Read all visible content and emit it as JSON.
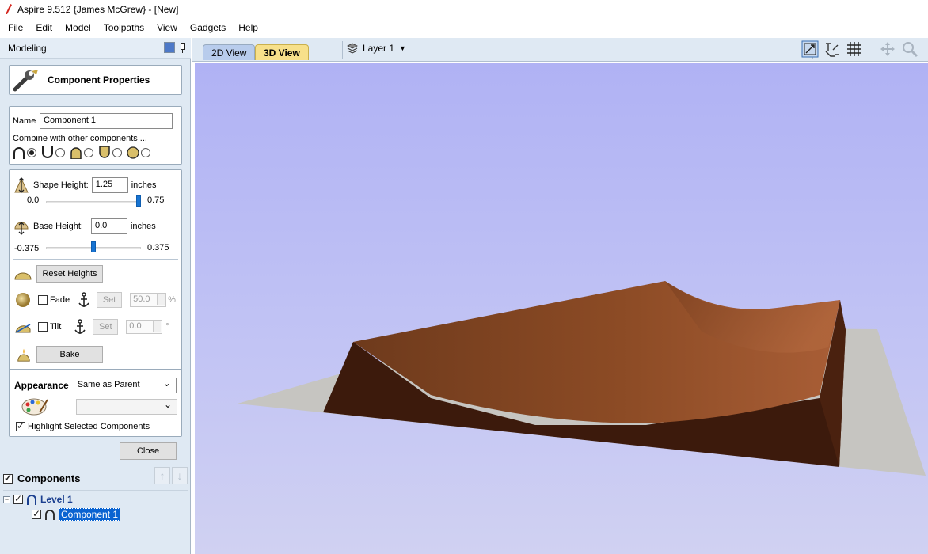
{
  "window": {
    "title": "Aspire 9.512 {James McGrew} - [New]"
  },
  "menu": [
    "File",
    "Edit",
    "Model",
    "Toolpaths",
    "View",
    "Gadgets",
    "Help"
  ],
  "left_panel": {
    "header": "Modeling",
    "form_title": "Component Properties",
    "name_label": "Name",
    "name_value": "Component 1",
    "combine_label": "Combine with other components ...",
    "shape_height": {
      "label": "Shape Height:",
      "value": "1.25",
      "unit": "inches",
      "slider_min": "0.0",
      "slider_max": "0.75",
      "slider_fraction": 1.0
    },
    "base_height": {
      "label": "Base Height:",
      "value": "0.0",
      "unit": "inches",
      "slider_min": "-0.375",
      "slider_max": "0.375",
      "slider_fraction": 0.5
    },
    "reset_label": "Reset Heights",
    "fade": {
      "label": "Fade",
      "set_label": "Set",
      "value": "50.0",
      "unit": "%"
    },
    "tilt": {
      "label": "Tilt",
      "set_label": "Set",
      "value": "0.0",
      "unit": "°"
    },
    "bake_label": "Bake",
    "appearance_label": "Appearance",
    "appearance_value": "Same as Parent",
    "highlight_label": "Highlight Selected Components",
    "close_label": "Close",
    "components_label": "Components",
    "tree": {
      "level": "Level 1",
      "component": "Component 1"
    }
  },
  "tabs": {
    "tab_2d": "2D View",
    "tab_3d": "3D View",
    "layer": "Layer 1"
  },
  "colors": {
    "surface_top": "#8a4a26",
    "wall": "#3c1a0c",
    "base_plane": "#c6c5c1",
    "sky_top": "#b0b2f4"
  }
}
